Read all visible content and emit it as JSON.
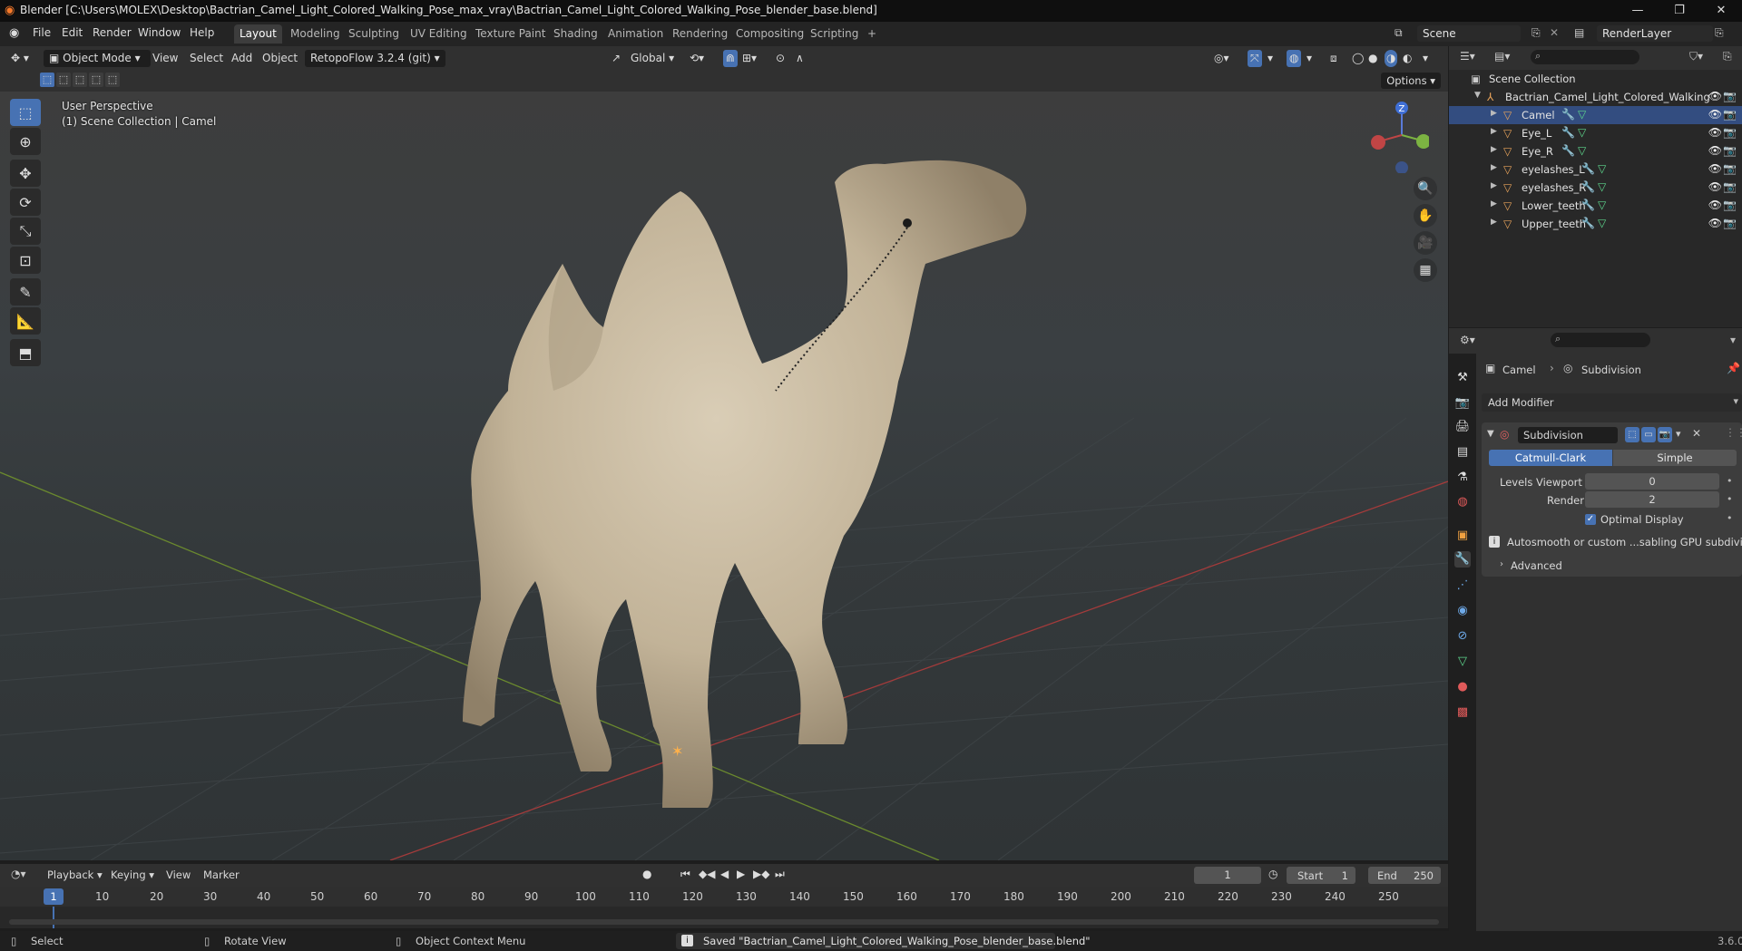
{
  "window": {
    "title": "Blender [C:\\Users\\MOLEX\\Desktop\\Bactrian_Camel_Light_Colored_Walking_Pose_max_vray\\Bactrian_Camel_Light_Colored_Walking_Pose_blender_base.blend]",
    "minimize": "—",
    "maximize": "❐",
    "close": "✕"
  },
  "menu": [
    "File",
    "Edit",
    "Render",
    "Window",
    "Help"
  ],
  "workspaces": [
    {
      "label": "Layout",
      "active": true
    },
    {
      "label": "Modeling"
    },
    {
      "label": "Sculpting"
    },
    {
      "label": "UV Editing"
    },
    {
      "label": "Texture Paint"
    },
    {
      "label": "Shading"
    },
    {
      "label": "Animation"
    },
    {
      "label": "Rendering"
    },
    {
      "label": "Compositing"
    },
    {
      "label": "Scripting"
    },
    {
      "label": "+"
    }
  ],
  "scene": {
    "label": "Scene",
    "render_layer": "RenderLayer"
  },
  "viewport_header": {
    "mode": "Object Mode",
    "view": "View",
    "select": "Select",
    "add": "Add",
    "object": "Object",
    "addon": "RetopoFlow 3.2.4 (git)",
    "transform": "Global",
    "options": "Options"
  },
  "viewport": {
    "perspective": "User Perspective",
    "collection": "(1) Scene Collection | Camel",
    "gizmo_z": "Z"
  },
  "outliner": {
    "root": "Scene Collection",
    "collection": "Bactrian_Camel_Light_Colored_Walking",
    "objects": [
      "Camel",
      "Eye_L",
      "Eye_R",
      "eyelashes_L",
      "eyelashes_R",
      "Lower_teeth",
      "Upper_teeth"
    ]
  },
  "properties": {
    "breadcrumb_object": "Camel",
    "breadcrumb_modifier": "Subdivision",
    "add_modifier": "Add Modifier",
    "modifier_name": "Subdivision",
    "catmull": "Catmull-Clark",
    "simple": "Simple",
    "levels_viewport_label": "Levels Viewport",
    "levels_viewport_value": "0",
    "render_label": "Render",
    "render_value": "2",
    "optimal_display": "Optimal Display",
    "info": "Autosmooth or custom ...sabling GPU subdivision",
    "advanced": "Advanced"
  },
  "timeline": {
    "playback": "Playback",
    "keying": "Keying",
    "view": "View",
    "marker": "Marker",
    "current_frame": "1",
    "start_label": "Start",
    "start": "1",
    "end_label": "End",
    "end": "250",
    "ticks": [
      "10",
      "20",
      "30",
      "40",
      "50",
      "60",
      "70",
      "80",
      "90",
      "100",
      "110",
      "120",
      "130",
      "140",
      "150",
      "160",
      "170",
      "180",
      "190",
      "200",
      "210",
      "220",
      "230",
      "240",
      "250"
    ]
  },
  "statusbar": {
    "select": "Select",
    "rotate": "Rotate View",
    "context": "Object Context Menu",
    "message": "Saved \"Bactrian_Camel_Light_Colored_Walking_Pose_blender_base.blend\"",
    "version": "3.6.0"
  },
  "colors": {
    "accent": "#4772b3",
    "object_icon": "#e8a35a",
    "mesh_icon": "#5dd68c"
  }
}
